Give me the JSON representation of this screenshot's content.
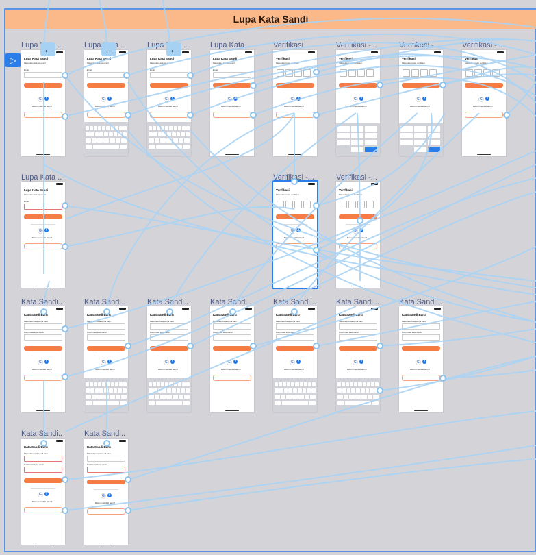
{
  "section": {
    "title": "Lupa Kata Sandi"
  },
  "frames": [
    {
      "label": "Lupa Kata ...",
      "title": "Lupa Kata Sandi"
    },
    {
      "label": "Lupa Kata ...",
      "title": "Lupa Kata Sandi"
    },
    {
      "label": "Lupa Kata ...",
      "title": "Lupa Kata Sandi"
    },
    {
      "label": "Lupa Kata ...",
      "title": "Lupa Kata Sandi"
    },
    {
      "label": "Verifikasi",
      "title": "Verifikasi"
    },
    {
      "label": "Verifikasi -...",
      "title": "Verifikasi"
    },
    {
      "label": "Verifikasi -...",
      "title": "Verifikasi"
    },
    {
      "label": "Verifikasi -...",
      "title": "Verifikasi"
    },
    {
      "label": "Lupa Kata ...",
      "title": "Lupa Kata Sandi"
    },
    {
      "label": "Verifikasi -...",
      "title": "Verifikasi"
    },
    {
      "label": "Verifikasi -...",
      "title": "Verifikasi"
    },
    {
      "label": "Kata Sandi...",
      "title": "Kata Sandi Baru"
    },
    {
      "label": "Kata Sandi...",
      "title": "Kata Sandi Baru"
    },
    {
      "label": "Kata Sandi...",
      "title": "Kata Sandi Baru"
    },
    {
      "label": "Kata Sandi...",
      "title": "Kata Sandi Baru"
    },
    {
      "label": "Kata Sandi...",
      "title": "Kata Sandi Baru"
    },
    {
      "label": "Kata Sandi...",
      "title": "Kata Sandi Baru"
    },
    {
      "label": "Kata Sandi...",
      "title": "Kata Sandi Baru"
    },
    {
      "label": "Kata Sandi...",
      "title": "Kata Sandi Baru"
    },
    {
      "label": "Kata Sandi...",
      "title": "Kata Sandi Baru"
    }
  ],
  "back_icon": "arrow-back-icon",
  "prototype_icon": "play-prototype-icon",
  "colors": {
    "accent": "#f57c45",
    "header": "#fbb98a",
    "wire": "#a9d3f5",
    "selection": "#2b7de9"
  }
}
